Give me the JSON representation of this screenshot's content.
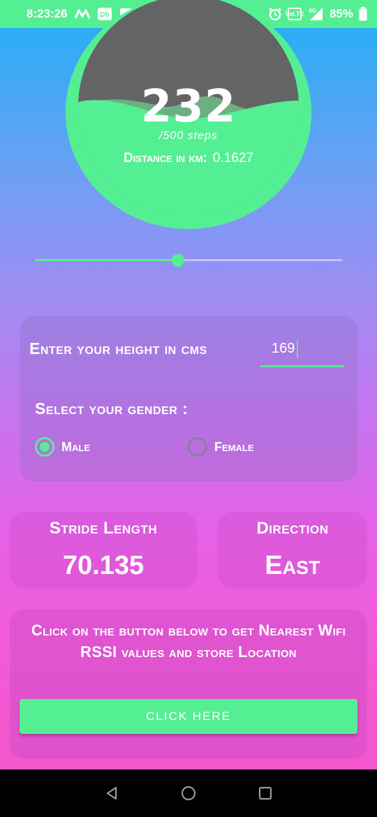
{
  "status_bar": {
    "time": "8:23:26",
    "battery": "85%",
    "icons": [
      "motorola-icon",
      "app-icon",
      "gallery-icon",
      "alarm-icon",
      "volte-icon",
      "signal-4g-icon",
      "battery-icon"
    ],
    "network_label": "4G",
    "volte_label": "VoLTE"
  },
  "gauge": {
    "steps": "232",
    "steps_total": "/500 steps",
    "distance_label": "Distance in km:",
    "distance_value": "0.1627"
  },
  "slider": {
    "value_fraction": 0.465
  },
  "height_section": {
    "label": "Enter your height in cms",
    "value": "169",
    "gender_label": "Select your gender :",
    "options": [
      {
        "label": "Male",
        "selected": true
      },
      {
        "label": "Female",
        "selected": false
      }
    ]
  },
  "stride": {
    "title": "Stride Length",
    "value": "70.135"
  },
  "direction": {
    "title": "Direction",
    "value": "East"
  },
  "wifi": {
    "text": "Click on the button below to get Nearest Wifi RSSI values and store Location",
    "button_label": "CLICK HERE"
  },
  "colors": {
    "accent": "#55ef93",
    "gauge_bg": "#646464",
    "nav_bar": "#000000"
  },
  "nav_bar": {
    "icons": [
      "back-icon",
      "home-icon",
      "recents-icon"
    ]
  }
}
